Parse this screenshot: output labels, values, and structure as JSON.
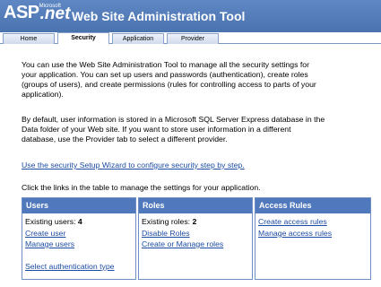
{
  "header": {
    "logo_asp": "ASP",
    "logo_ms": "Microsoft",
    "logo_net": ".net",
    "title": "Web Site Administration Tool"
  },
  "tabs": [
    {
      "label": "Home",
      "active": false
    },
    {
      "label": "Security",
      "active": true
    },
    {
      "label": "Application",
      "active": false
    },
    {
      "label": "Provider",
      "active": false
    }
  ],
  "intro": {
    "line1": "You can use the Web Site Administration Tool to manage all the security settings for",
    "line2": "your application. You can set up users and passwords (authentication), create roles",
    "line3": "(groups of users), and create permissions (rules for controlling access to parts of your",
    "line4": "application)."
  },
  "storage": {
    "line1": "By default, user information is stored in a Microsoft SQL Server Express database in the",
    "line2": "Data folder of your Web site. If you want to store user information in a different",
    "line3": "database, use the Provider tab to select a different provider."
  },
  "wizard_link": "Use the security Setup Wizard to configure security step by step.",
  "table_intro": "Click the links in the table to manage the settings for your application.",
  "users": {
    "heading": "Users",
    "existing_label": "Existing users: ",
    "existing_count": "4",
    "create": "Create user",
    "manage": "Manage users",
    "auth_type": "Select authentication type"
  },
  "roles": {
    "heading": "Roles",
    "existing_label": "Existing roles: ",
    "existing_count": "2",
    "disable": "Disable Roles",
    "create_manage": "Create or Manage roles"
  },
  "access": {
    "heading": "Access Rules",
    "create": "Create access rules",
    "manage": "Manage access rules"
  },
  "colors": {
    "header_bg": "#5e87c3",
    "table_head_bg": "#4f78bd",
    "link": "#1c4ba3"
  }
}
